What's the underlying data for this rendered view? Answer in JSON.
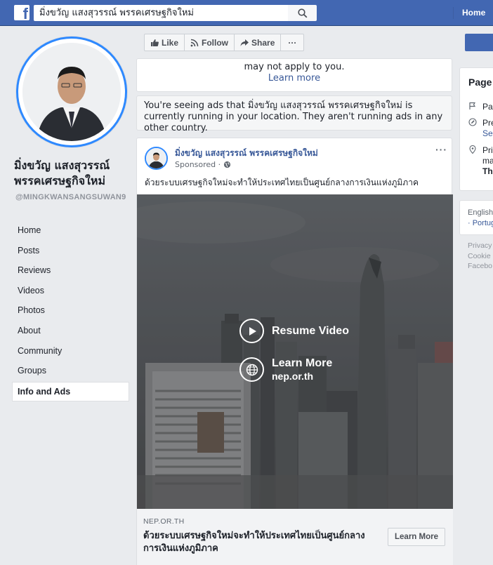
{
  "topbar": {
    "search_value": "มิ่งขวัญ แสงสุวรรณ์ พรรคเศรษฐกิจใหม่",
    "home_label": "Home"
  },
  "profile": {
    "name": "มิ่งขวัญ แสงสุวรรณ์ พรรคเศรษฐกิจใหม่",
    "handle": "@MINGKWANSANGSUWAN9"
  },
  "nav": [
    {
      "label": "Home"
    },
    {
      "label": "Posts"
    },
    {
      "label": "Reviews"
    },
    {
      "label": "Videos"
    },
    {
      "label": "Photos"
    },
    {
      "label": "About"
    },
    {
      "label": "Community"
    },
    {
      "label": "Groups"
    },
    {
      "label": "Info and Ads",
      "active": true
    }
  ],
  "actions": {
    "like": "Like",
    "follow": "Follow",
    "share": "Share",
    "more": "···"
  },
  "ads_notice": {
    "text": "may not apply to you.",
    "learn_more": "Learn more",
    "running": "You're seeing ads that มิ่งขวัญ แสงสุวรรณ์ พรรคเศรษฐกิจใหม่ is currently running in your location. They aren't running ads in any other country."
  },
  "post": {
    "author": "มิ่งขวัญ แสงสุวรรณ์ พรรคเศรษฐกิจใหม่",
    "sponsored": "Sponsored ·",
    "more": "···",
    "text": "ด้วยระบบเศรษฐกิจใหม่จะทำให้ประเทศไทยเป็นศูนย์กลางการเงินแห่งภูมิภาค",
    "video": {
      "resume": "Resume Video",
      "learn_more": "Learn More",
      "site": "nep.or.th"
    },
    "link": {
      "domain": "NEP.OR.TH",
      "headline": "ด้วยระบบเศรษฐกิจใหม่จะทำให้ประเทศไทยเป็นศูนย์กลางการเงินแห่งภูมิภาค",
      "button": "Learn More"
    }
  },
  "right": {
    "title": "Page",
    "rows": [
      "Pa",
      "Pre",
      "Se",
      "Pri",
      "ma",
      "Th"
    ],
    "lang": [
      "English",
      "· Portug"
    ],
    "footer": [
      "Privacy",
      "Cookie",
      "Facebo"
    ]
  }
}
